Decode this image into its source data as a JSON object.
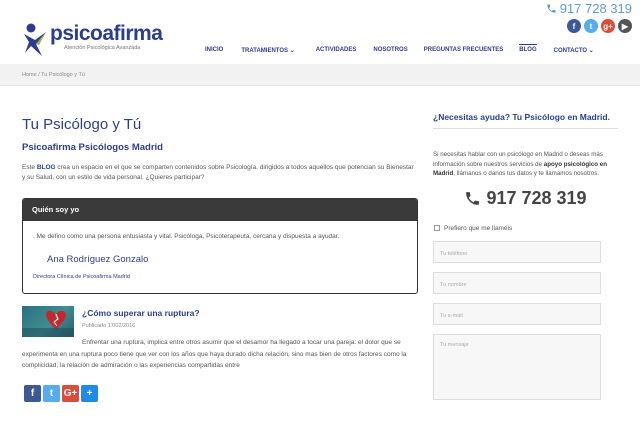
{
  "header": {
    "phone": "917 728 319",
    "logo_name": "psicoafirma",
    "logo_tagline": "Atención Psicológica Avanzada",
    "social": [
      {
        "name": "facebook",
        "glyph": "f",
        "color": "#3b5998"
      },
      {
        "name": "twitter",
        "glyph": "t",
        "color": "#55acee"
      },
      {
        "name": "google-plus",
        "glyph": "g+",
        "color": "#dd4b39"
      },
      {
        "name": "youtube",
        "glyph": "▶",
        "color": "#555555"
      }
    ]
  },
  "nav": {
    "items": [
      "INICIO",
      "TRATAMIENTOS",
      "ACTIVIDADES",
      "NOSOTROS",
      "PREGUNTAS FRECUENTES",
      "BLOG",
      "CONTACTO"
    ]
  },
  "breadcrumb": "Home  /  Tu Psicólogo y Tú",
  "main": {
    "title": "Tu Psicólogo y Tú",
    "subtitle": "Psicoafirma Psicólogos Madrid",
    "intro_prefix": "Este ",
    "intro_bold": "BLOG",
    "intro_rest": " crea un espacio en el que se comparten contenidos sobre Psicología, dirigidos a todos aquellos que potencian su Bienestar y su Salud, con un estilo de vida personal. ¿Quieres participar?",
    "who_box": {
      "header": "Quién soy yo",
      "text": ". Me defino como una persona entusiasta y vital. Psicóloga, Psicoterapeuta, cercana y dispuesta a ayudar.",
      "name": "Ana Rodríguez Gonzalo",
      "role": "Directora Clínica de Psicoafirma Madrid"
    },
    "post": {
      "title": "¿Cómo superar una ruptura?",
      "date": "Publicado 17/02/2016",
      "excerpt": "Enfrentar una ruptura, implica entre otros asumir que el desamor ha llegado a tocar una pareja: el dolor que se experimenta en una ruptura poco tiene que ver con los años que haya durado dicha relación, sino mas bien de otros factores como la complicidad, la relación de admiración o las experiencias compartidas entre"
    },
    "share": [
      {
        "name": "facebook",
        "glyph": "f",
        "color": "#3b5998"
      },
      {
        "name": "twitter",
        "glyph": "t",
        "color": "#55acee"
      },
      {
        "name": "google-plus",
        "glyph": "G+",
        "color": "#dd4b39"
      },
      {
        "name": "share",
        "glyph": "+",
        "color": "#1e8be8"
      }
    ]
  },
  "sidebar": {
    "title": "¿Necesitas ayuda? Tu Psicólogo en Madrid.",
    "text_prefix": "Si necesitas hablar con un psicólogo en Madrid o deseas más información sobre nuestros servicios de ",
    "text_bold1": "apoyo psicológico en Madrid",
    "text_rest": ", llámanos o danos tus datos y te llamamos nosotros.",
    "phone": "917 728 319",
    "checkbox_label": "Prefiero que me llaméis",
    "placeholders": {
      "phone": "Tu teléfono",
      "name": "Tu nombre",
      "email": "Tu e-mail",
      "message": "Tu mensaje"
    }
  }
}
